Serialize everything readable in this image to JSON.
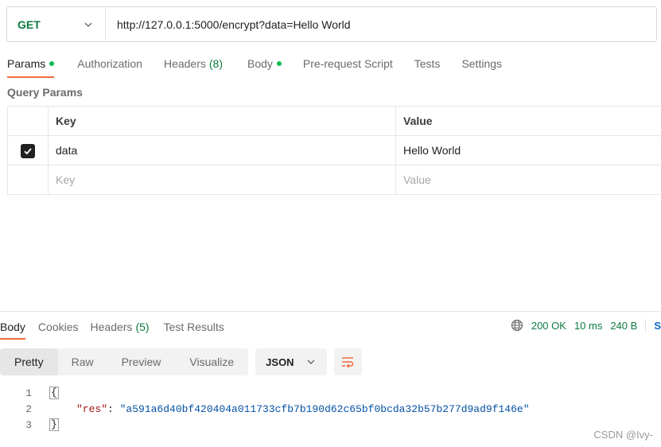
{
  "request": {
    "method": "GET",
    "url": "http://127.0.0.1:5000/encrypt?data=Hello World"
  },
  "request_tabs": [
    {
      "label": "Params",
      "dot": true,
      "active": true
    },
    {
      "label": "Authorization"
    },
    {
      "label": "Headers",
      "count": "(8)"
    },
    {
      "label": "Body",
      "dot": true
    },
    {
      "label": "Pre-request Script"
    },
    {
      "label": "Tests"
    },
    {
      "label": "Settings"
    }
  ],
  "query_params": {
    "section_label": "Query Params",
    "headers": {
      "key": "Key",
      "value": "Value"
    },
    "rows": [
      {
        "checked": true,
        "key": "data",
        "value": "Hello World"
      }
    ],
    "new_row": {
      "key_placeholder": "Key",
      "value_placeholder": "Value"
    }
  },
  "response_tabs": [
    {
      "label": "Body",
      "active": true
    },
    {
      "label": "Cookies"
    },
    {
      "label": "Headers",
      "count": "(5)"
    },
    {
      "label": "Test Results"
    }
  ],
  "response_status": {
    "status": "200 OK",
    "time": "10 ms",
    "size": "240 B",
    "save_label": "S"
  },
  "view_modes": [
    "Pretty",
    "Raw",
    "Preview",
    "Visualize"
  ],
  "active_view_mode": "Pretty",
  "format": "JSON",
  "response_body": {
    "line_numbers": [
      "1",
      "2",
      "3"
    ],
    "open_brace": "{",
    "key": "\"res\"",
    "colon": ": ",
    "value": "\"a591a6d40bf420404a011733cfb7b190d62c65bf0bcda32b57b277d9ad9f146e\"",
    "close_brace": "}"
  },
  "watermark": "CSDN @Ivy-",
  "colors": {
    "method_green": "#0c7b3f",
    "active_tab_underline": "#f26b3a",
    "dot_green": "#0cbb52",
    "json_key": "#a31515",
    "json_string": "#0451a5",
    "wrap_icon": "#f26b3a"
  }
}
